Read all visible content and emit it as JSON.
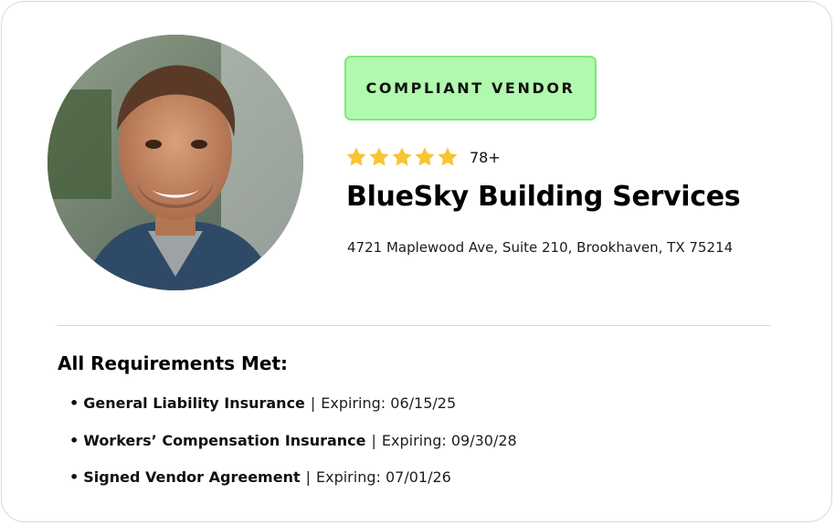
{
  "badge": {
    "label": "COMPLIANT VENDOR",
    "bg_color": "#b1f9ae",
    "border_color": "#7ee87a"
  },
  "rating": {
    "stars": 5,
    "max_stars": 5,
    "count_label": "78+",
    "star_color": "#f7c531"
  },
  "vendor": {
    "name": "BlueSky Building Services",
    "address": "4721 Maplewood Ave, Suite 210, Brookhaven, TX 75214"
  },
  "avatar": {
    "icon": "vendor-photo"
  },
  "requirements": {
    "heading": "All Requirements Met:",
    "separator": "|",
    "items": [
      {
        "name": "General Liability Insurance",
        "expiry": "Expiring: 06/15/25"
      },
      {
        "name": "Workers’ Compensation Insurance",
        "expiry": "Expiring: 09/30/28"
      },
      {
        "name": "Signed Vendor Agreement",
        "expiry": "Expiring: 07/01/26"
      }
    ]
  }
}
